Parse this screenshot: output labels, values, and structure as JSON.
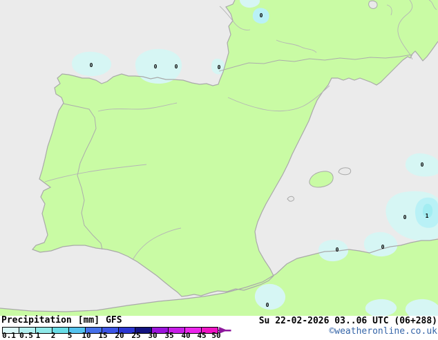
{
  "legend": {
    "title": "Precipitation",
    "unit": "[mm]",
    "model": "GFS",
    "scale_values": [
      "0.1",
      "0.5",
      "1",
      "2",
      "5",
      "10",
      "15",
      "20",
      "25",
      "30",
      "35",
      "40",
      "45",
      "50"
    ],
    "scale_colors": [
      "#d9f8f8",
      "#b2f0f0",
      "#8fe9e9",
      "#68dce6",
      "#55c3ef",
      "#4570e9",
      "#3c55e5",
      "#2b36d2",
      "#12127f",
      "#9b13dc",
      "#c71ee7",
      "#ed26ed",
      "#ef13c4"
    ],
    "overflow_arrow_color": "#8d179c"
  },
  "status": {
    "timestamp": "Su 22-02-2026 03..06 UTC (06+288)",
    "copyright": "©weatheronline.co.uk",
    "copyright_color": "#3565a8"
  },
  "map": {
    "colors": {
      "sea": "#ebebeb",
      "land": "#c9fba4",
      "coastline": "#a9a9a9",
      "border": "#acacac",
      "river": "#b5b5b5",
      "precip_light": "#d6f6f4",
      "precip_medium": "#b9f1f6",
      "precip_heavy": "#a2edf2",
      "value_label": "#000000"
    },
    "point_labels": [
      {
        "value": "0"
      },
      {
        "value": "0"
      },
      {
        "value": "0"
      },
      {
        "value": "0"
      },
      {
        "value": "0"
      },
      {
        "value": "0"
      },
      {
        "value": "0"
      },
      {
        "value": "1"
      },
      {
        "value": "0"
      },
      {
        "value": "0"
      },
      {
        "value": "0"
      }
    ]
  }
}
